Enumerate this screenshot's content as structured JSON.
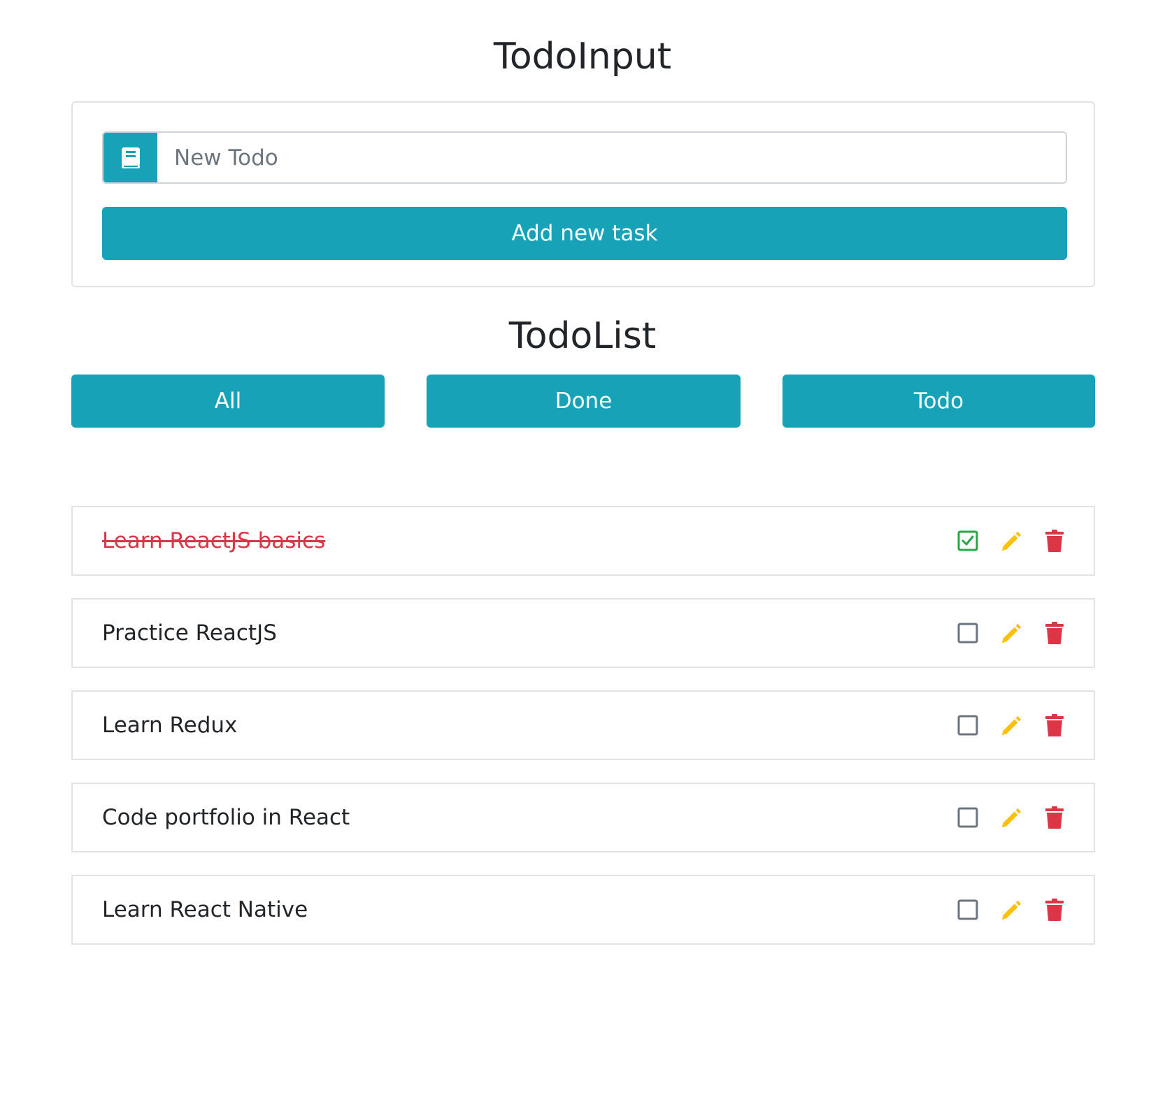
{
  "todo_input": {
    "title": "TodoInput",
    "input_value": "",
    "input_placeholder": "New Todo",
    "input_icon": "book-icon",
    "add_button_label": "Add new task"
  },
  "todo_list": {
    "title": "TodoList",
    "filters": [
      {
        "label": "All"
      },
      {
        "label": "Done"
      },
      {
        "label": "Todo"
      }
    ],
    "items": [
      {
        "text": "Learn ReactJS basics",
        "done": true
      },
      {
        "text": "Practice ReactJS",
        "done": false
      },
      {
        "text": "Learn Redux",
        "done": false
      },
      {
        "text": "Code portfolio in React",
        "done": false
      },
      {
        "text": "Learn React Native",
        "done": false
      }
    ]
  },
  "colors": {
    "primary": "#17a2b8",
    "done_text": "#dc3545",
    "checkbox_checked": "#28a745",
    "checkbox_unchecked": "#6c757d",
    "edit_icon": "#ffc107",
    "delete_icon": "#dc3545"
  }
}
